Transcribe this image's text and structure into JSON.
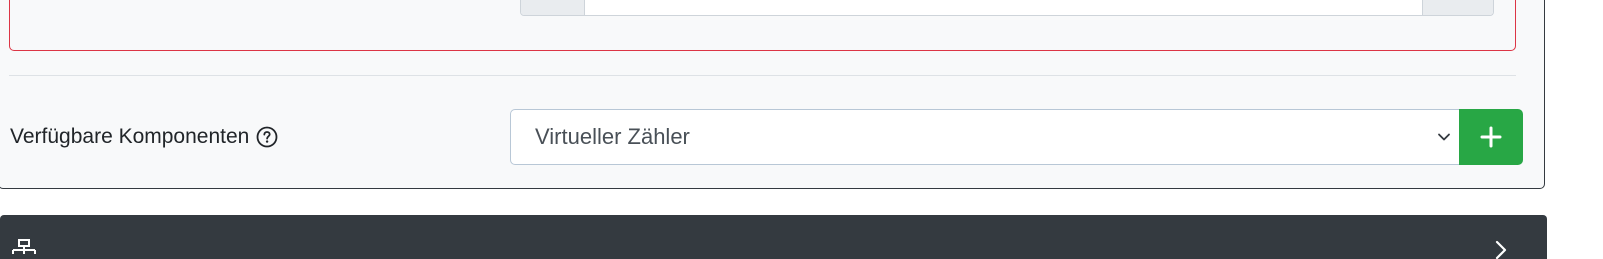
{
  "components": {
    "label": "Verfügbare Komponenten",
    "help_icon": "question-circle-icon",
    "selected_value": "Virtueller Zähler",
    "add_button_icon": "plus-icon"
  },
  "colors": {
    "card_bg": "#f8f9fa",
    "error_border": "#dc3545",
    "add_button": "#28a745",
    "dark_bar": "#343a40"
  },
  "section_header": {
    "icon": "network-icon",
    "toggle_icon": "chevron-right-icon"
  }
}
